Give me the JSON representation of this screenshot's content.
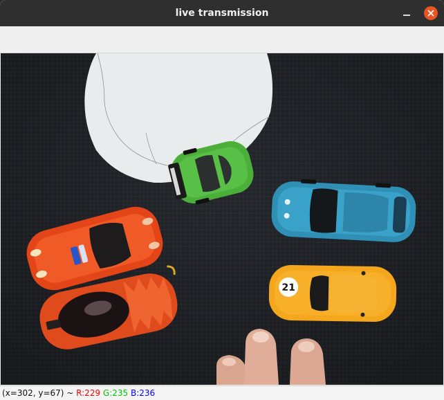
{
  "window": {
    "title": "live transmission"
  },
  "status": {
    "coords": "(x=302, y=67) ~ ",
    "r": "R:229",
    "g": "G:235",
    "b": "B:236",
    "colors": {
      "r": "#ff0000",
      "g": "#00c800",
      "b": "#0000ff"
    }
  },
  "scene": {
    "car_number": "21"
  }
}
